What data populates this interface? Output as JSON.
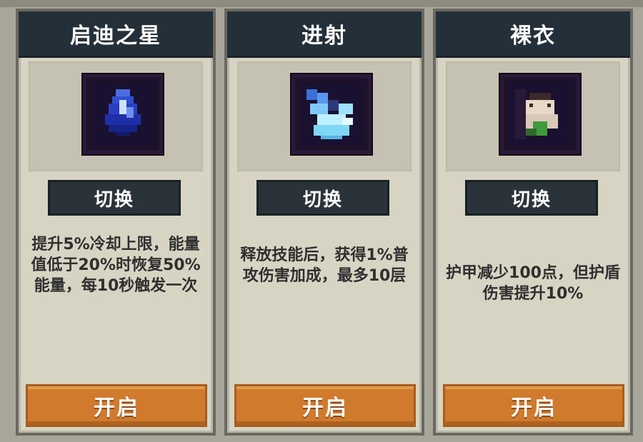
{
  "cards": [
    {
      "title": "启迪之星",
      "icon": "blue-crystal-icon",
      "switch_label": "切换",
      "description": "提升5%冷却上限，能量值低于20%时恢复50%能量，每10秒触发一次",
      "open_label": "开启"
    },
    {
      "title": "进射",
      "icon": "ice-burst-icon",
      "switch_label": "切换",
      "description": "释放技能后，获得1%普攻伤害加成，最多10层",
      "open_label": "开启"
    },
    {
      "title": "裸衣",
      "icon": "character-portrait-icon",
      "switch_label": "切换",
      "description": "护甲减少100点，但护盾伤害提升10%",
      "open_label": "开启"
    }
  ],
  "colors": {
    "header": "#243039",
    "button_switch": "#2a333a",
    "button_open": "#d07a2e",
    "card_bg": "#d8d4c4"
  }
}
